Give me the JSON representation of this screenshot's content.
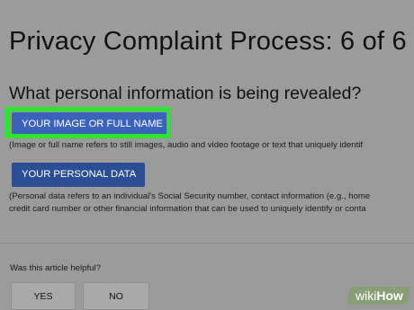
{
  "page": {
    "title": "Privacy Complaint Process: 6 of 6"
  },
  "question": {
    "heading": "What personal information is being revealed?"
  },
  "options": [
    {
      "label": "YOUR IMAGE OR FULL NAME",
      "description_lines": [
        "(Image or full name refers to still images, audio and video footage or text that uniquely identif"
      ],
      "highlighted": true
    },
    {
      "label": "YOUR PERSONAL DATA",
      "description_lines": [
        "(Personal data refers to an individual's Social Security number, contact information (e.g., home",
        "credit card number or other financial information that can be used to uniquely identify or conta"
      ],
      "highlighted": false
    }
  ],
  "feedback": {
    "prompt": "Was this article helpful?",
    "yes_label": "YES",
    "no_label": "NO"
  },
  "watermark": {
    "prefix": "wiki",
    "suffix": "How"
  },
  "colors": {
    "background": "#9b9b9b",
    "button_primary": "#2a4d94",
    "button_highlighted": "#3b63ba",
    "highlight_outline": "#2ee52e"
  }
}
